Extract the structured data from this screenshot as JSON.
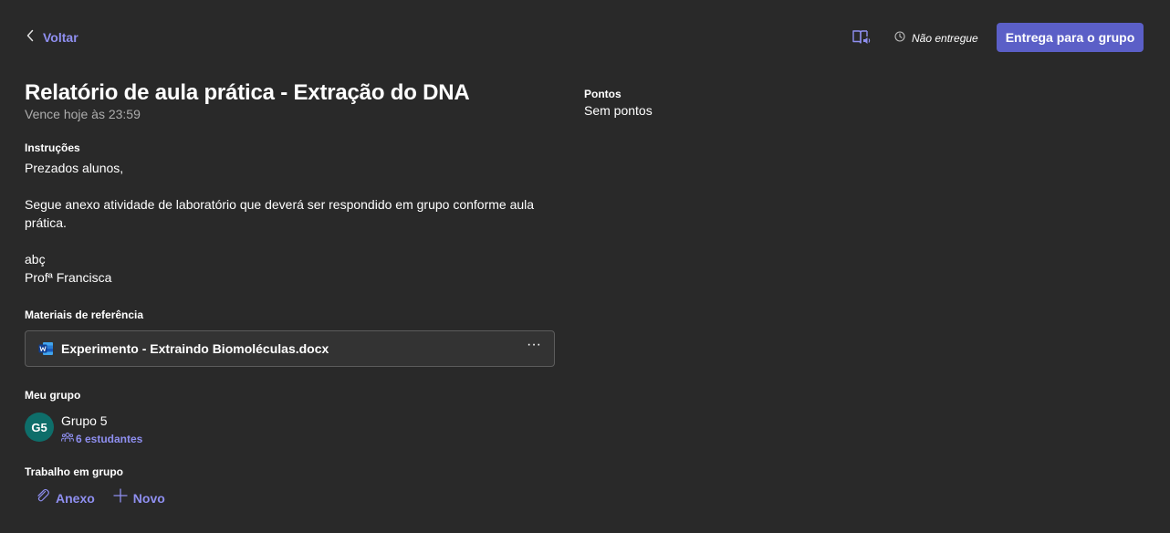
{
  "header": {
    "back_label": "Voltar",
    "status_text": "Não entregue",
    "submit_label": "Entrega para o grupo",
    "reader_icon": "immersive-reader-icon",
    "status_icon": "clock-icon"
  },
  "assignment": {
    "title": "Relatório de aula prática - Extração do DNA",
    "due": "Vence hoje às 23:59",
    "instructions_label": "Instruções",
    "instructions": [
      "Prezados alunos,",
      "",
      "Segue anexo atividade de laboratório que deverá ser respondido em grupo conforme aula prática.",
      "",
      "abç",
      "Profª Francisca"
    ]
  },
  "materials": {
    "label": "Materiais de referência",
    "file_name": "Experimento - Extraindo Biomoléculas.docx",
    "file_icon": "word-document-icon",
    "more_label": "···"
  },
  "group": {
    "label": "Meu grupo",
    "avatar_initials": "G5",
    "name": "Grupo 5",
    "members": "6 estudantes"
  },
  "work": {
    "label": "Trabalho em grupo",
    "attach_label": "Anexo",
    "new_label": "Novo"
  },
  "points": {
    "label": "Pontos",
    "value": "Sem pontos"
  },
  "colors": {
    "background": "#292929",
    "accent": "#5b5fc7",
    "link": "#8f8ff0",
    "avatar": "#0e6e6a",
    "muted_text": "#adadad"
  }
}
